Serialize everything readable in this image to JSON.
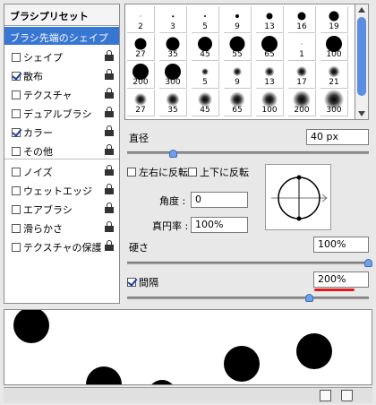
{
  "left_panel": {
    "header": "ブラシプリセット",
    "selected": "ブラシ先端のシェイプ",
    "options": [
      {
        "label": "シェイプ",
        "checked": false
      },
      {
        "label": "散布",
        "checked": true
      },
      {
        "label": "テクスチャ",
        "checked": false
      },
      {
        "label": "デュアルブラシ",
        "checked": false
      },
      {
        "label": "カラー",
        "checked": true
      },
      {
        "label": "その他",
        "checked": false
      },
      {
        "label": "ノイズ",
        "checked": false
      },
      {
        "label": "ウェットエッジ",
        "checked": false
      },
      {
        "label": "エアブラシ",
        "checked": false
      },
      {
        "label": "滑らかさ",
        "checked": false
      },
      {
        "label": "テクスチャの保護",
        "checked": false
      }
    ]
  },
  "brush_grid": {
    "row1": [
      "2",
      "3",
      "5",
      "9",
      "13",
      "16",
      "19"
    ],
    "row2": [
      "27",
      "35",
      "45",
      "55",
      "65",
      "1",
      "100"
    ],
    "row3": [
      "200",
      "300",
      "5",
      "9",
      "13",
      "17",
      "21"
    ],
    "row4": [
      "27",
      "35",
      "45",
      "65",
      "100",
      "200",
      "300"
    ]
  },
  "diameter": {
    "label": "直径",
    "value": "40 px"
  },
  "flip": {
    "x_label": "左右に反転",
    "y_label": "上下に反転"
  },
  "angle": {
    "label": "角度 :",
    "value": "0"
  },
  "roundness": {
    "label": "真円率 :",
    "value": "100%"
  },
  "hardness": {
    "label": "硬さ",
    "value": "100%"
  },
  "spacing": {
    "label": "間隔",
    "value": "200%",
    "checked": true
  },
  "icons": {
    "lock": "lock-icon",
    "new": "new-preset-icon",
    "trash": "trash-icon"
  }
}
